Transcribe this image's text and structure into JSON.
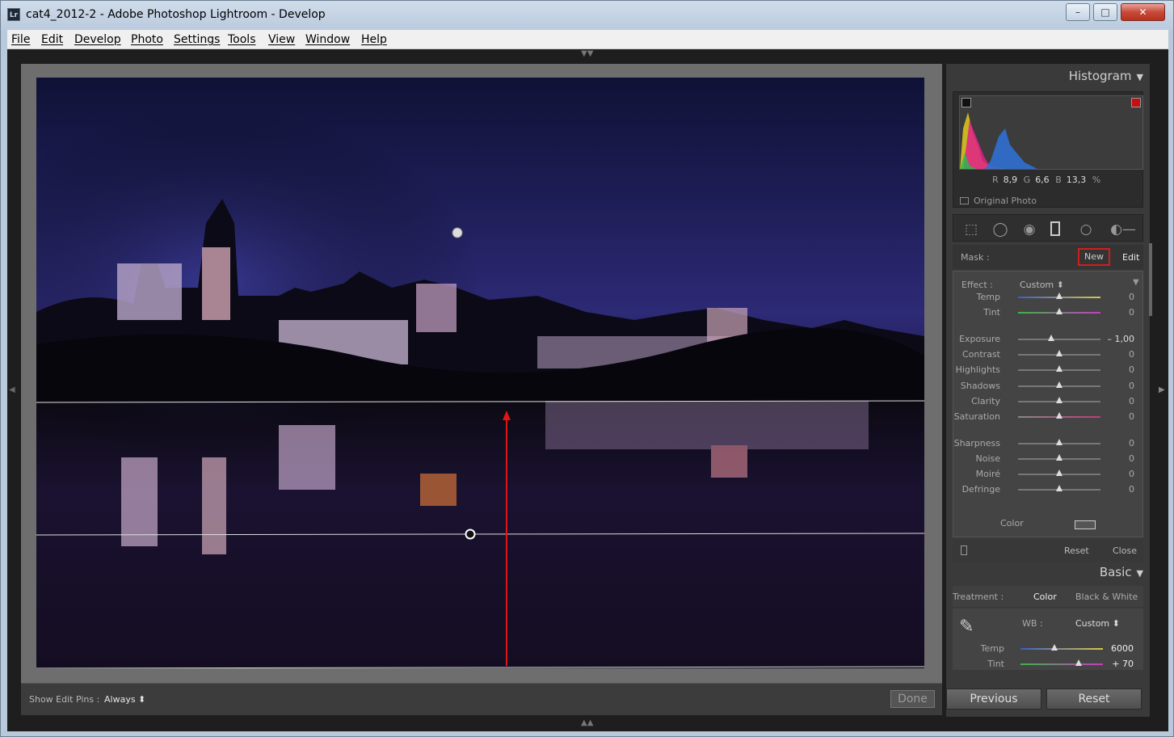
{
  "window": {
    "title": "cat4_2012-2 - Adobe Photoshop Lightroom - Develop",
    "app_icon": "Lr",
    "controls": {
      "minimize": "–",
      "maximize": "□",
      "close": "✕"
    }
  },
  "menu": [
    "File",
    "Edit",
    "Develop",
    "Photo",
    "Settings",
    "Tools",
    "View",
    "Window",
    "Help"
  ],
  "toolbar": {
    "show_edit_pins_label": "Show Edit Pins :",
    "show_edit_pins_value": "Always ⬍",
    "done_label": "Done"
  },
  "histogram": {
    "title": "Histogram",
    "r_label": "R",
    "r_value": "8,9",
    "g_label": "G",
    "g_value": "6,6",
    "b_label": "B",
    "b_value": "13,3",
    "percent": "%",
    "original_photo": "Original Photo"
  },
  "mask": {
    "label": "Mask :",
    "new": "New",
    "edit": "Edit"
  },
  "effect": {
    "label": "Effect :",
    "value": "Custom ⬍",
    "sliders": [
      {
        "label": "Temp",
        "value": "0",
        "level": 0.5
      },
      {
        "label": "Tint",
        "value": "0",
        "level": 0.5
      },
      {
        "label": "Exposure",
        "value": "– 1,00",
        "level": 0.4
      },
      {
        "label": "Contrast",
        "value": "0",
        "level": 0.5
      },
      {
        "label": "Highlights",
        "value": "0",
        "level": 0.5
      },
      {
        "label": "Shadows",
        "value": "0",
        "level": 0.5
      },
      {
        "label": "Clarity",
        "value": "0",
        "level": 0.5
      },
      {
        "label": "Saturation",
        "value": "0",
        "level": 0.5
      },
      {
        "label": "Sharpness",
        "value": "0",
        "level": 0.5
      },
      {
        "label": "Noise",
        "value": "0",
        "level": 0.5
      },
      {
        "label": "Moiré",
        "value": "0",
        "level": 0.5
      },
      {
        "label": "Defringe",
        "value": "0",
        "level": 0.5
      }
    ],
    "color_label": "Color"
  },
  "adj_footer": {
    "reset": "Reset",
    "close": "Close"
  },
  "basic": {
    "title": "Basic",
    "treatment_label": "Treatment :",
    "color": "Color",
    "bw": "Black & White",
    "wb_label": "WB :",
    "wb_value": "Custom ⬍",
    "temp_label": "Temp",
    "temp_value": "6000",
    "temp_level": 0.42,
    "tint_label": "Tint",
    "tint_value": "+ 70",
    "tint_level": 0.72
  },
  "buttons": {
    "previous": "Previous",
    "reset": "Reset"
  }
}
